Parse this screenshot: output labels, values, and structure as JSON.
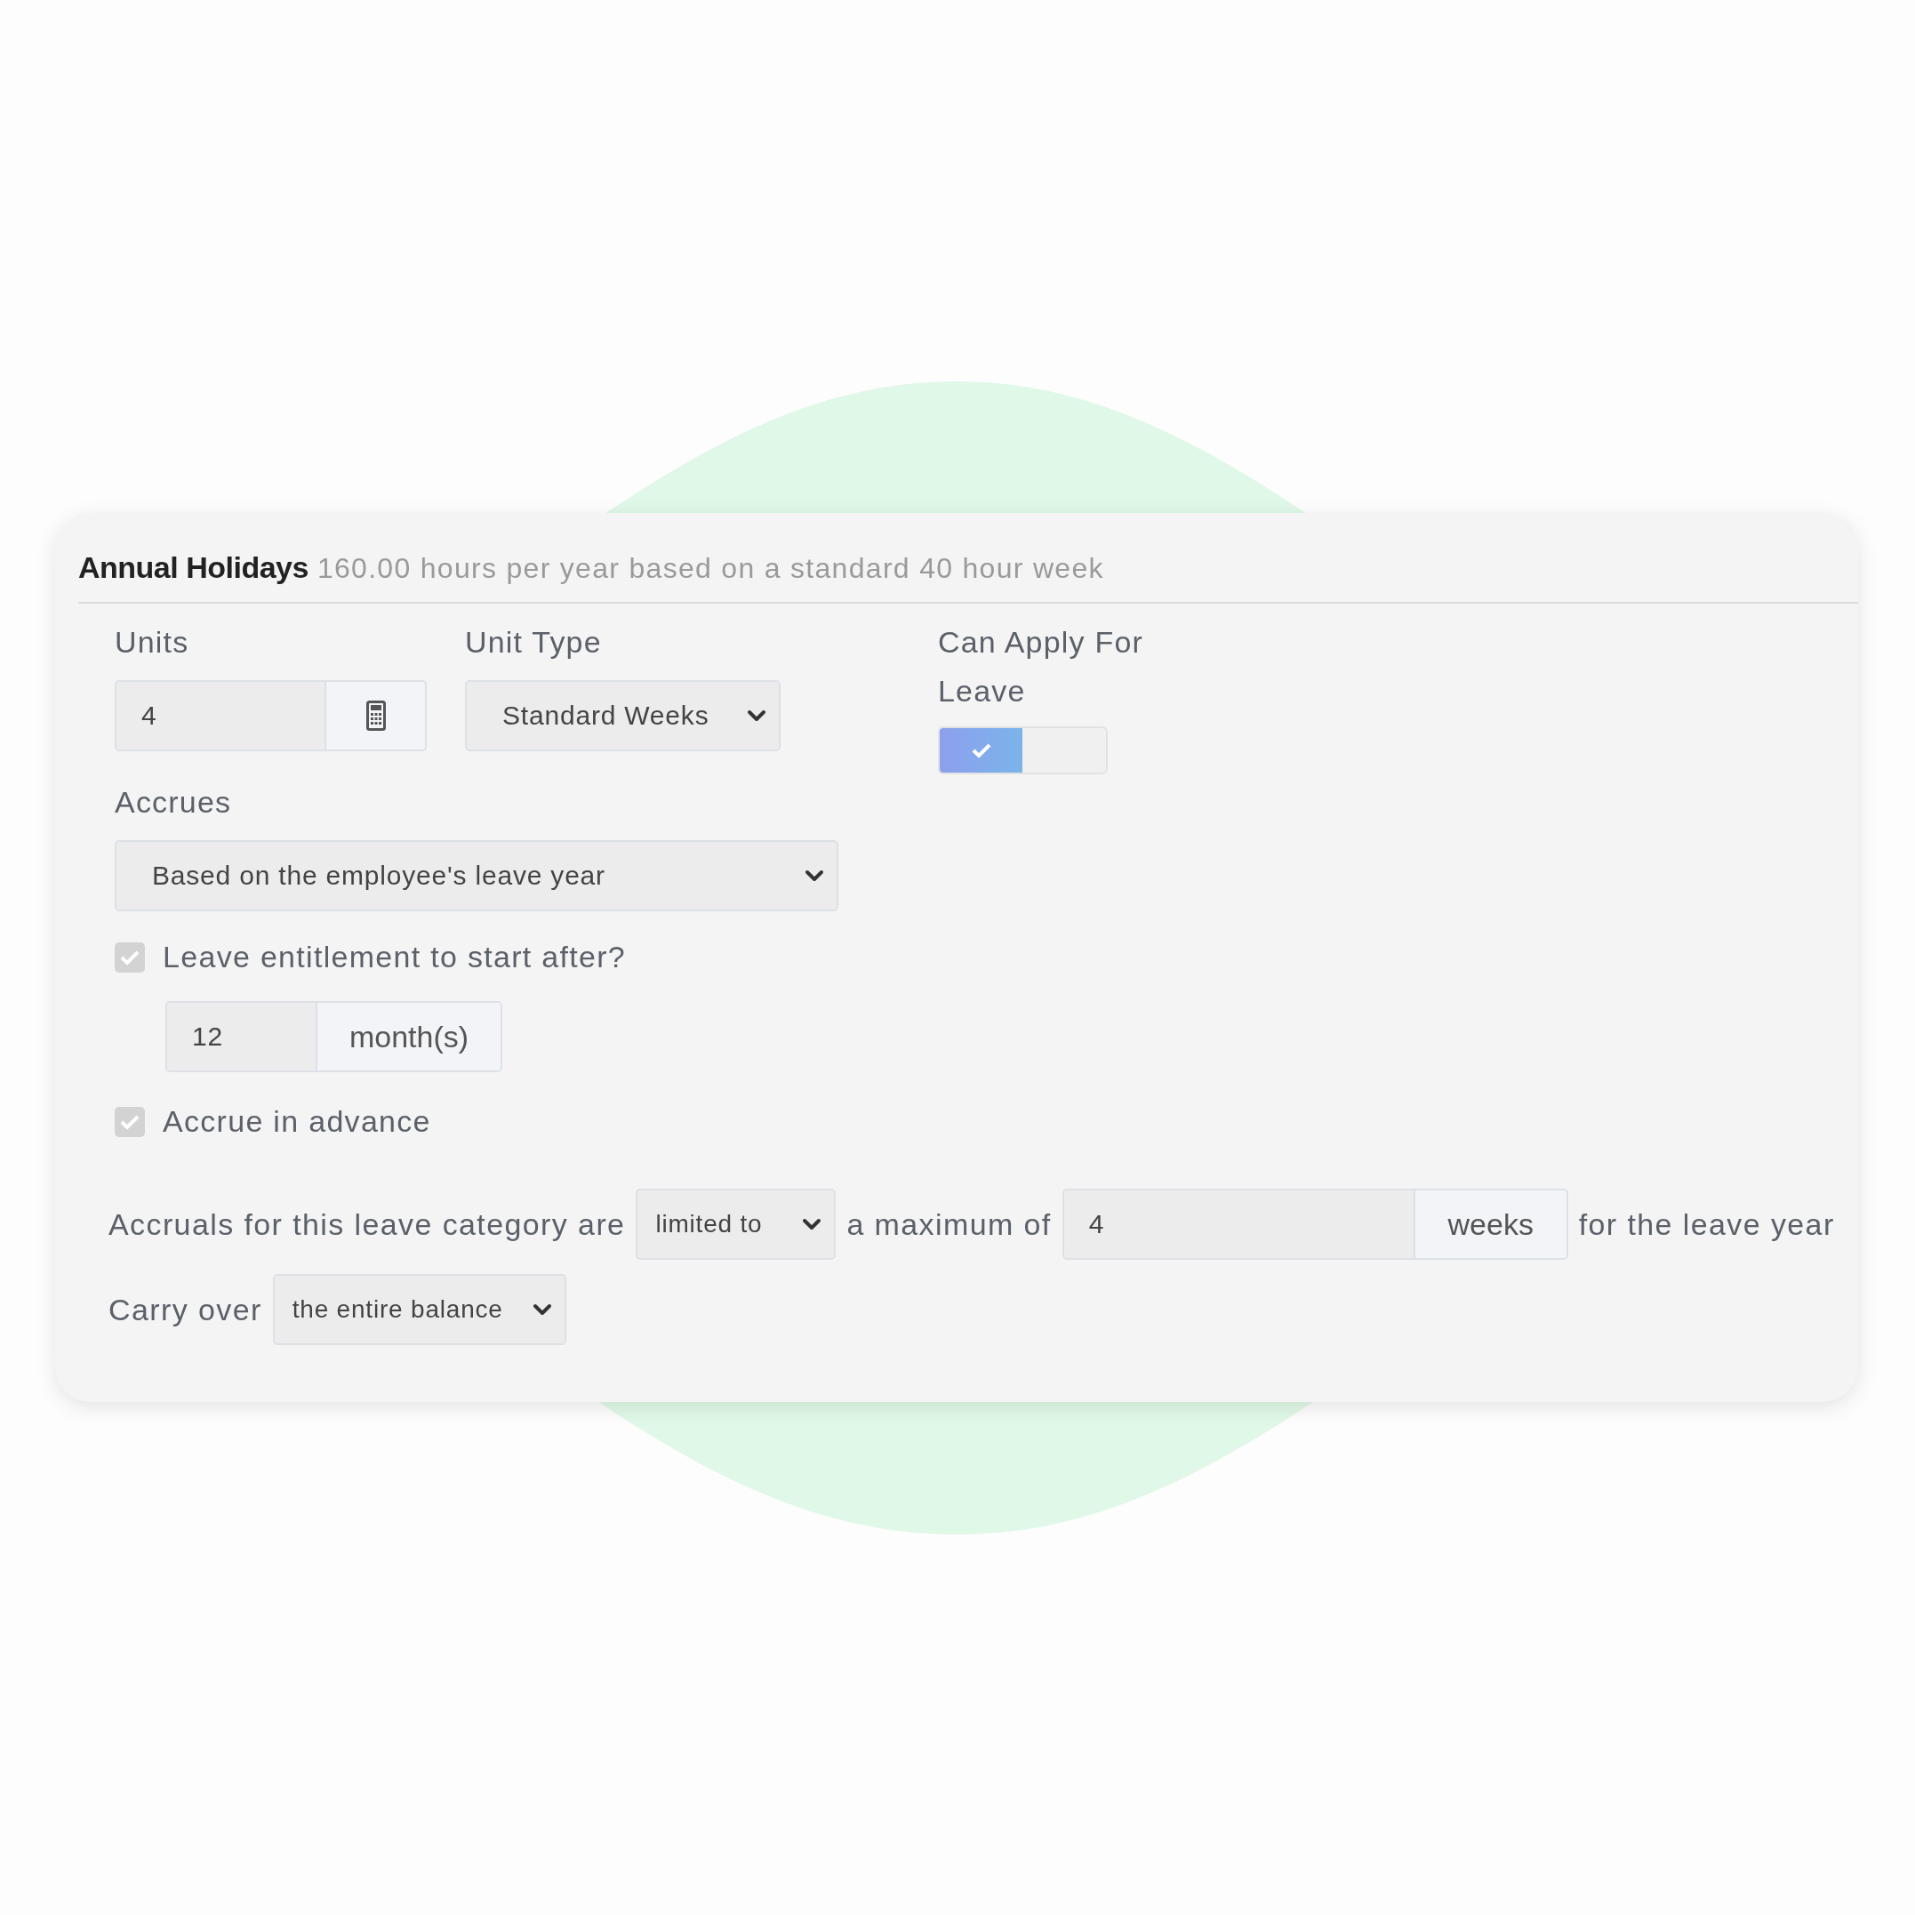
{
  "card": {
    "title": "Annual Holidays",
    "subtitle": "160.00 hours per year based on a standard 40 hour week"
  },
  "units": {
    "label": "Units",
    "value": "4"
  },
  "unit_type": {
    "label": "Unit Type",
    "value": "Standard Weeks"
  },
  "can_apply": {
    "label": "Can Apply For Leave",
    "on": true
  },
  "accrues": {
    "label": "Accrues",
    "value": "Based on the employee's leave year"
  },
  "start_after": {
    "label": "Leave entitlement to start after?",
    "checked": true,
    "value": "12",
    "unit": "month(s)"
  },
  "accrue_in_advance": {
    "label": "Accrue in advance",
    "checked": true
  },
  "limit_sentence": [
    {
      "kind": "text",
      "text": "Accruals for this leave category are"
    },
    {
      "kind": "select",
      "value": "limited to"
    },
    {
      "kind": "text",
      "text": "a maximum of"
    },
    {
      "kind": "input",
      "value": "4",
      "unit": "weeks"
    },
    {
      "kind": "text",
      "text": "for the leave year"
    }
  ],
  "carry_sentence": [
    {
      "kind": "text",
      "text": "Carry over"
    },
    {
      "kind": "select",
      "value": "the entire balance"
    }
  ]
}
